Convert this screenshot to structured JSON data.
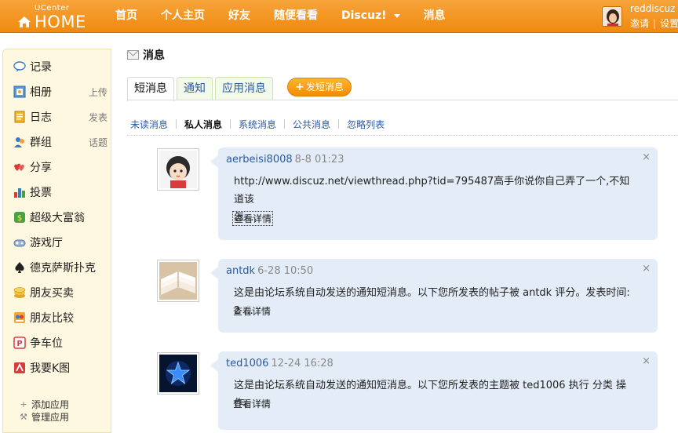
{
  "header": {
    "logo_small": "UCenter",
    "logo_big": "HOME",
    "nav": [
      "首页",
      "个人主页",
      "好友",
      "随便看看",
      "Discuz!",
      "消息"
    ],
    "username": "reddiscuz",
    "invite": "邀请",
    "settings": "设置"
  },
  "sidebar": {
    "items": [
      {
        "label": "记录",
        "icon": "record-icon"
      },
      {
        "label": "相册",
        "extra": "上传",
        "icon": "album-icon"
      },
      {
        "label": "日志",
        "extra": "发表",
        "icon": "blog-icon"
      },
      {
        "label": "群组",
        "extra": "话题",
        "icon": "group-icon"
      },
      {
        "label": "分享",
        "icon": "share-icon"
      },
      {
        "label": "投票",
        "icon": "poll-icon"
      },
      {
        "label": "超级大富翁",
        "icon": "monopoly-icon"
      },
      {
        "label": "游戏厅",
        "icon": "gamepad-icon"
      },
      {
        "label": "德克萨斯扑克",
        "icon": "spade-icon"
      },
      {
        "label": "朋友买卖",
        "icon": "coins-icon"
      },
      {
        "label": "朋友比较",
        "icon": "compare-icon"
      },
      {
        "label": "争车位",
        "icon": "parking-icon"
      },
      {
        "label": "我要K图",
        "icon": "kpic-icon"
      }
    ],
    "add_app": "添加应用",
    "manage_app": "管理应用"
  },
  "main": {
    "title": "消息",
    "tabs": [
      "短消息",
      "通知",
      "应用消息"
    ],
    "compose": "发短消息",
    "subtabs": [
      "未读消息",
      "私人消息",
      "系统消息",
      "公共消息",
      "忽略列表"
    ],
    "messages": [
      {
        "name": "aerbeisi8008",
        "time": "8-8 01:23",
        "line1": "http://www.discuz.net/viewthread.php?tid=795487高手你说你自己弄了一个,不知道该",
        "line2": "怎  ...",
        "more": "查看详情",
        "close": "×"
      },
      {
        "name": "antdk",
        "time": "6-28 10:50",
        "line1": "这是由论坛系统自动发送的通知短消息。以下您所发表的帖子被  antdk  评分。发表时间: 2 ...",
        "more": "查看详情",
        "close": "×"
      },
      {
        "name": "ted1006",
        "time": "12-24 16:28",
        "line1": "这是由论坛系统自动发送的通知短消息。以下您所发表的主题被  ted1006  执行  分类  操作。 ...",
        "more": "查看详情",
        "close": "×"
      }
    ]
  },
  "colors": {
    "accent": "#f08a10",
    "link": "#2a5a9f",
    "bubble": "#e3ecf7",
    "sidebar": "#fdf8df"
  }
}
